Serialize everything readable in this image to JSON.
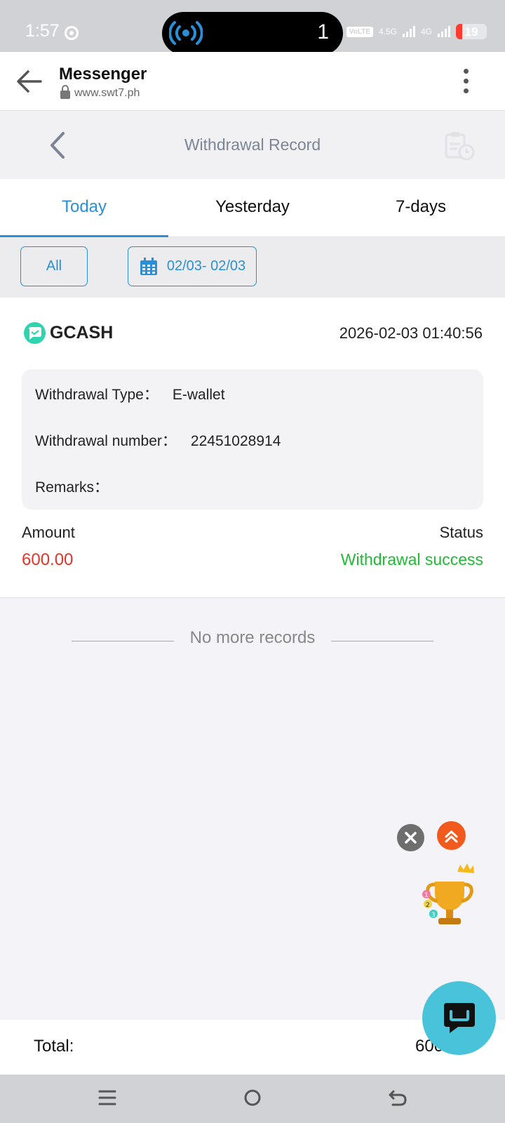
{
  "status_bar": {
    "time": "1:57",
    "island_count": "1",
    "volte": "VoLTE",
    "net1": "4.5G",
    "net2": "4G",
    "battery": "19"
  },
  "browser": {
    "title": "Messenger",
    "url": "www.swt7.ph"
  },
  "page": {
    "title": "Withdrawal Record"
  },
  "tabs": [
    {
      "label": "Today",
      "active": true
    },
    {
      "label": "Yesterday",
      "active": false
    },
    {
      "label": "7-days",
      "active": false
    }
  ],
  "filters": {
    "all_label": "All",
    "date_range": "02/03- 02/03"
  },
  "record": {
    "provider": "GCASH",
    "datetime": "2026-02-03 01:40:56",
    "type_label": "Withdrawal Type：",
    "type_value": "E-wallet",
    "number_label": "Withdrawal number：",
    "number_value": "22451028914",
    "remarks_label": "Remarks：",
    "remarks_value": "",
    "amount_label": "Amount",
    "amount_value": "600.00",
    "status_label": "Status",
    "status_value": "Withdrawal success"
  },
  "no_more_text": "No more records",
  "total": {
    "label": "Total:",
    "value": "600"
  },
  "colors": {
    "accent": "#2b8fd6",
    "amount": "#e2342a",
    "success": "#21b936"
  }
}
